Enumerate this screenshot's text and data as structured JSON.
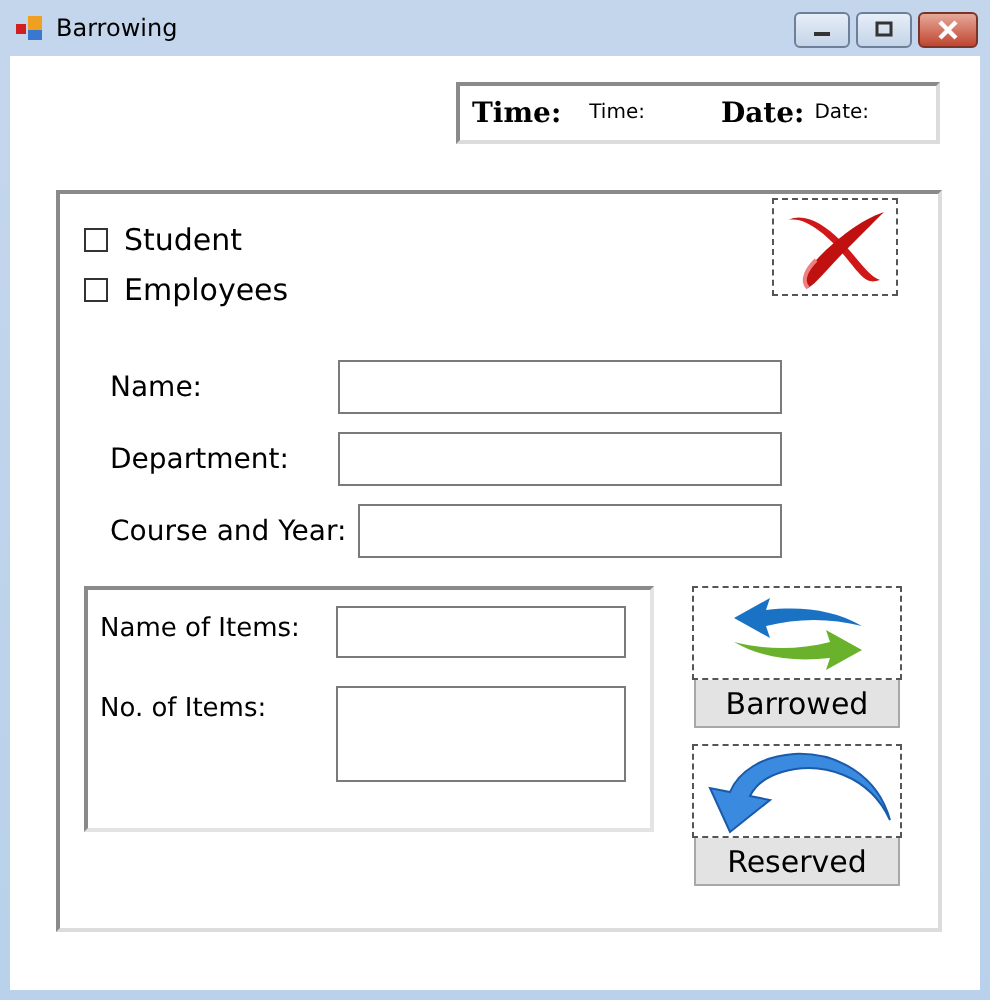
{
  "window": {
    "title": "Barrowing"
  },
  "clock": [
    {
      "label": "Time:",
      "value": "Time:"
    },
    {
      "label": "Date:",
      "value": "Date:"
    }
  ],
  "user_types": [
    {
      "label": "Student",
      "checked": false
    },
    {
      "label": "Employees",
      "checked": false
    }
  ],
  "fields": [
    {
      "label": "Name:"
    },
    {
      "label": "Department:"
    },
    {
      "label": "Course and Year:"
    }
  ],
  "item_fields": [
    {
      "label": "Name of Items:",
      "kind": "single"
    },
    {
      "label": "No. of Items:",
      "kind": "multi"
    }
  ],
  "actions": [
    {
      "kind": "exchange",
      "label": "Barrowed"
    },
    {
      "kind": "return",
      "label": "Reserved"
    }
  ]
}
